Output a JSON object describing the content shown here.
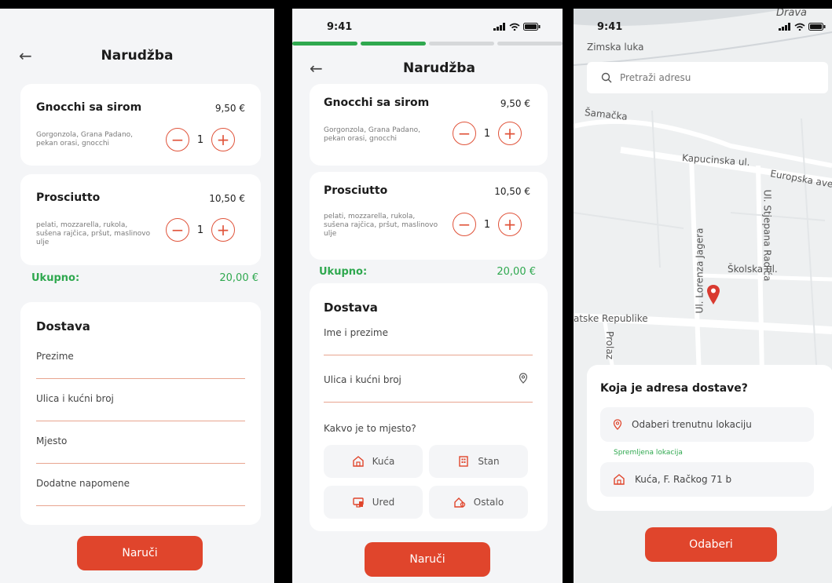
{
  "screen1": {
    "title": "Narudžba",
    "items": [
      {
        "name": "Gnocchi sa sirom",
        "price": "9,50 €",
        "desc": "Gorgonzola, Grana Padano, pekan orasi, gnocchi",
        "qty": "1"
      },
      {
        "name": "Prosciutto",
        "price": "10,50 €",
        "desc": "pelati, mozzarella, rukola, sušena rajčica, pršut, maslinovo ulje",
        "qty": "1"
      }
    ],
    "total_label": "Ukupno:",
    "total_value": "20,00 €",
    "delivery_title": "Dostava",
    "fields": [
      "Prezime",
      "Ulica i kućni broj",
      "Mjesto",
      "Dodatne napomene"
    ],
    "order_button": "Naruči"
  },
  "screen2": {
    "time": "9:41",
    "title": "Narudžba",
    "progress_steps": [
      true,
      true,
      false,
      false
    ],
    "items": [
      {
        "name": "Gnocchi sa sirom",
        "price": "9,50 €",
        "desc": "Gorgonzola, Grana Padano, pekan orasi, gnocchi",
        "qty": "1"
      },
      {
        "name": "Prosciutto",
        "price": "10,50 €",
        "desc": "pelati, mozzarella, rukola, sušena rajčica, pršut, maslinovo ulje",
        "qty": "1"
      }
    ],
    "total_label": "Ukupno:",
    "total_value": "20,00 €",
    "delivery_title": "Dostava",
    "name_field": "Ime i prezime",
    "street_field": "Ulica i kućni broj",
    "place_question": "Kakvo je to mjesto?",
    "place_types": [
      "Kuća",
      "Stan",
      "Ured",
      "Ostalo"
    ],
    "order_button": "Naruči"
  },
  "screen3": {
    "time": "9:41",
    "map_labels": [
      "Drava",
      "Zimska luka",
      "Šamačka",
      "Kapucinska ul.",
      "Europska ave",
      "Ul. Stjepana Radića",
      "Ul. Lorenza Jagera",
      "Školska ul.",
      "atske Republike",
      "Prolaz"
    ],
    "search_placeholder": "Pretraži adresu",
    "sheet_title": "Koja je adresa dostave?",
    "current_location": "Odaberi trenutnu lokaciju",
    "saved_label": "Spremljena lokacija",
    "saved_address": "Kuća, F. Račkog 71 b",
    "choose_button": "Odaberi"
  },
  "colors": {
    "accent": "#e0452c",
    "green": "#2fa84f",
    "progress_active": "#2fa84f",
    "progress_inactive": "#d6d8da"
  }
}
